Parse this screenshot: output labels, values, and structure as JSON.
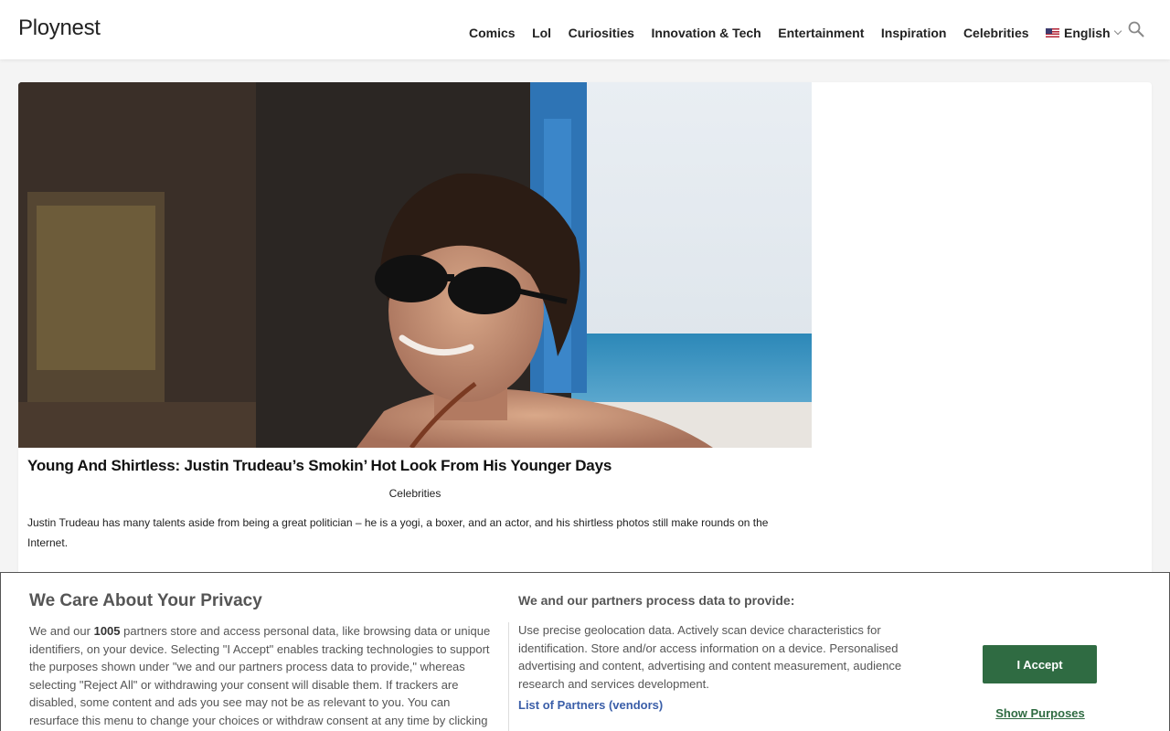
{
  "site": {
    "logo": "Ploynest"
  },
  "nav": {
    "items": [
      {
        "label": "Comics"
      },
      {
        "label": "Lol"
      },
      {
        "label": "Curiosities"
      },
      {
        "label": "Innovation & Tech"
      },
      {
        "label": "Entertainment"
      },
      {
        "label": "Inspiration"
      },
      {
        "label": "Celebrities"
      }
    ],
    "language": "English",
    "language_icon": "us-flag-icon",
    "search_icon": "search-icon"
  },
  "article": {
    "title": "Young And Shirtless: Justin Trudeau’s Smokin’ Hot Look From His Younger Days",
    "category": "Celebrities",
    "excerpt": "Justin Trudeau has many talents aside from being a great politician – he is a yogi, a boxer, and an actor, and his shirtless photos still make rounds on the Internet."
  },
  "consent": {
    "title": "We Care About Your Privacy",
    "intro_before": "We and our ",
    "partner_count": "1005",
    "intro_after": " partners store and access personal data, like browsing data or unique identifiers, on your device. Selecting \"I Accept\" enables tracking technologies to support the purposes shown under \"we and our partners process data to provide,\" whereas selecting \"Reject All\" or withdrawing your consent will disable them. If trackers are disabled, some content and ads you see may not be as relevant to you. You can resurface this menu to change your choices or withdraw consent at any time by clicking",
    "right_title": "We and our partners process data to provide:",
    "right_text": "Use precise geolocation data. Actively scan device characteristics for identification. Store and/or access information on a device. Personalised advertising and content, advertising and content measurement, audience research and services development.",
    "partners_link": "List of Partners (vendors)",
    "accept_label": "I Accept",
    "purposes_label": "Show Purposes",
    "accent_color": "#2f6b42",
    "link_color": "#3a5ea8"
  }
}
